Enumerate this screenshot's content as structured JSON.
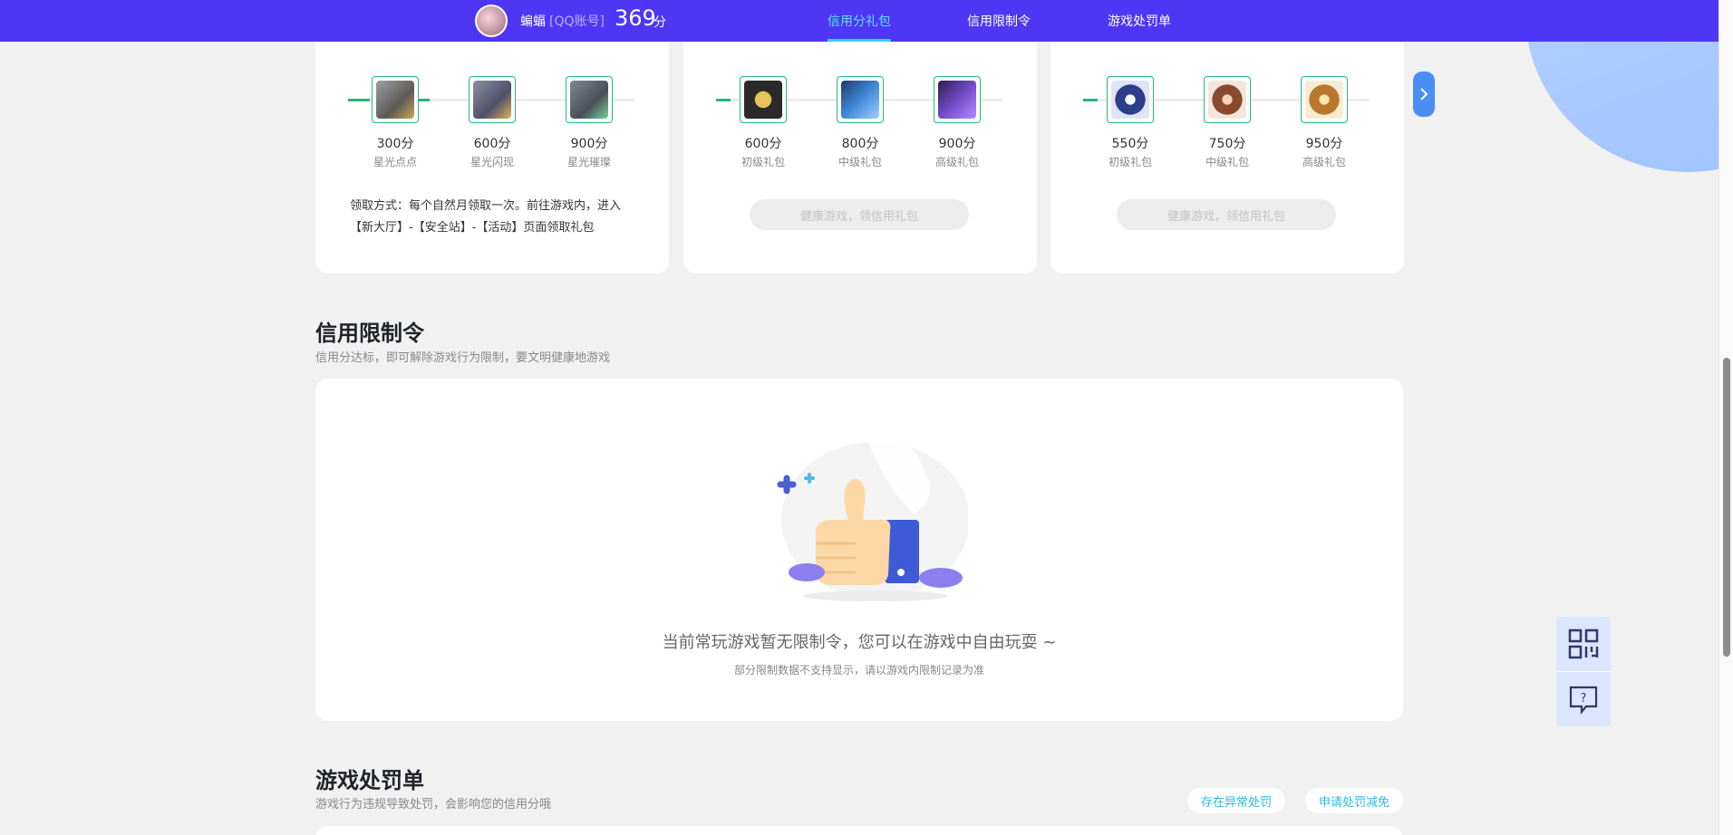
{
  "header": {
    "username": "蝙蝠",
    "account_type": "[QQ账号]",
    "score": "369",
    "score_unit": "分",
    "nav": [
      {
        "label": "信用分礼包",
        "active": true
      },
      {
        "label": "信用限制令",
        "active": false
      },
      {
        "label": "游戏处罚单",
        "active": false
      }
    ]
  },
  "gift_cards": [
    {
      "items": [
        {
          "score": "300分",
          "name": "星光点点"
        },
        {
          "score": "600分",
          "name": "星光闪现"
        },
        {
          "score": "900分",
          "name": "星光璀璨"
        }
      ],
      "note": "领取方式：每个自然月领取一次。前往游戏内，进入【新大厅】-【安全站】-【活动】页面领取礼包"
    },
    {
      "items": [
        {
          "score": "600分",
          "name": "初级礼包"
        },
        {
          "score": "800分",
          "name": "中级礼包"
        },
        {
          "score": "900分",
          "name": "高级礼包"
        }
      ],
      "button": "健康游戏，领信用礼包"
    },
    {
      "items": [
        {
          "score": "550分",
          "name": "初级礼包"
        },
        {
          "score": "750分",
          "name": "中级礼包"
        },
        {
          "score": "950分",
          "name": "高级礼包"
        }
      ],
      "button": "健康游戏，领信用礼包"
    }
  ],
  "restriction": {
    "title": "信用限制令",
    "subtitle": "信用分达标，即可解除游戏行为限制，要文明健康地游戏",
    "empty_title": "当前常玩游戏暂无限制令，您可以在游戏中自由玩耍 ~",
    "empty_sub": "部分限制数据不支持显示，请以游戏内限制记录为准"
  },
  "penalty": {
    "title": "游戏处罚单",
    "subtitle": "游戏行为违规导致处罚，会影响您的信用分哦",
    "btn_abnormal": "存在异常处罚",
    "btn_reduce": "申请处罚减免"
  },
  "colors": {
    "header": "#4f36f5",
    "accent": "#2fd7ff",
    "green": "#27b47a"
  }
}
